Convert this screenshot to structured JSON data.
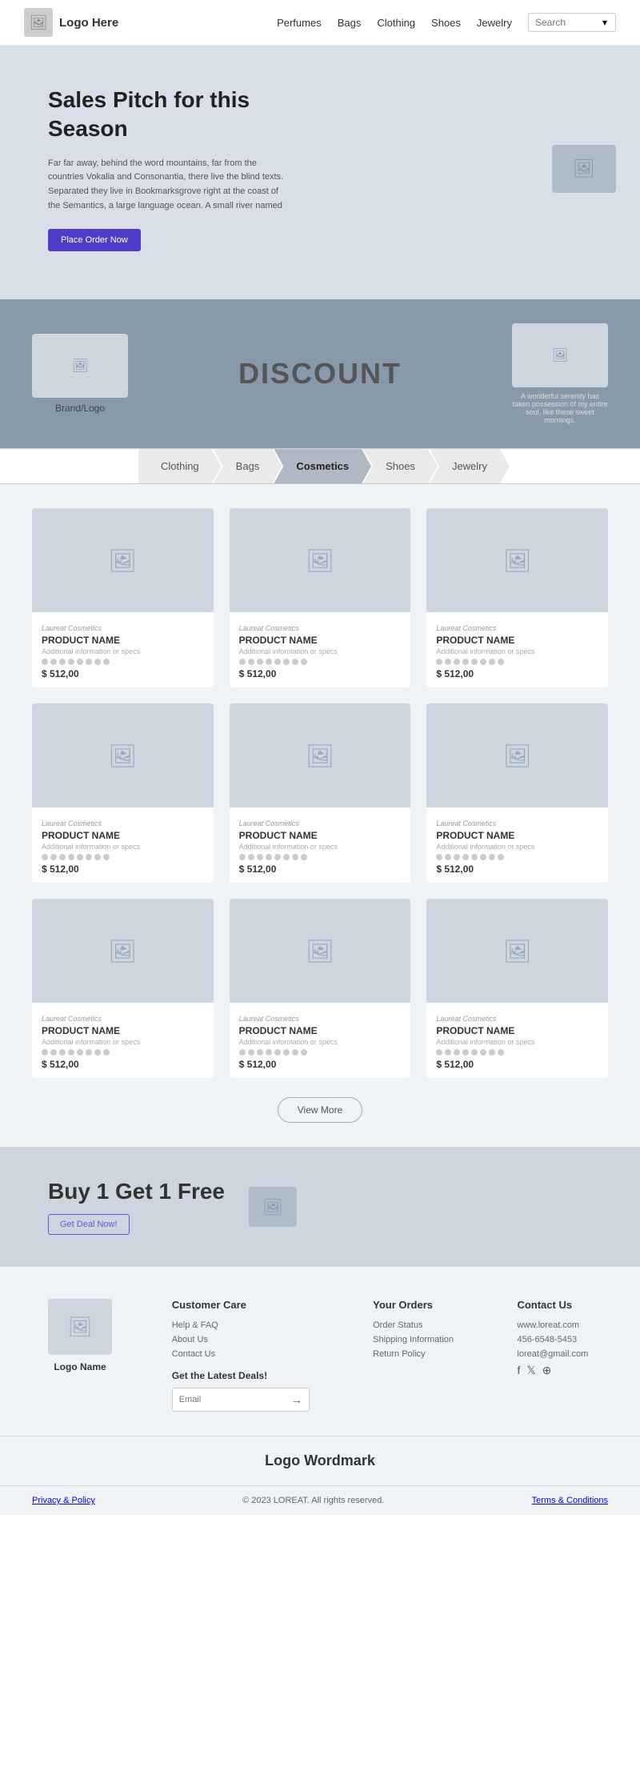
{
  "header": {
    "logo_text": "Logo Here",
    "nav_items": [
      "Perfumes",
      "Bags",
      "Clothing",
      "Shoes",
      "Jewelry"
    ],
    "search_placeholder": "Search"
  },
  "hero": {
    "title": "Sales Pitch for this Season",
    "description": "Far far away, behind the word mountains, far from the countries Vokalia and Consonantia, there live the blind texts. Separated they live in Bookmarksgrove right at the coast of the Semantics, a large language ocean. A small river named",
    "cta_label": "Place Order Now"
  },
  "discount": {
    "text": "DISCOUNT",
    "brand_label": "Brand/Logo",
    "right_text": "A wonderful serenity has taken possession of my entire soul, like these sweet mornings."
  },
  "category_tabs": [
    "Clothing",
    "Bags",
    "Cosmetics",
    "Shoes",
    "Jewelry"
  ],
  "active_tab": "Cosmetics",
  "products": [
    {
      "brand": "Laureat Cosmetics",
      "name": "PRODUCT NAME",
      "specs": "Additional information or specs",
      "price": "$ 512,00"
    },
    {
      "brand": "Laureat Cosmetics",
      "name": "PRODUCT NAME",
      "specs": "Additional information or specs",
      "price": "$ 512,00"
    },
    {
      "brand": "Laureat Cosmetics",
      "name": "PRODUCT NAME",
      "specs": "Additional information or specs",
      "price": "$ 512,00"
    },
    {
      "brand": "Laureat Cosmetics",
      "name": "PRODUCT NAME",
      "specs": "Additional information or specs",
      "price": "$ 512,00"
    },
    {
      "brand": "Laureat Cosmetics",
      "name": "PRODUCT NAME",
      "specs": "Additional information or specs",
      "price": "$ 512,00"
    },
    {
      "brand": "Laureat Cosmetics",
      "name": "PRODUCT NAME",
      "specs": "Additional information or specs",
      "price": "$ 512,00"
    },
    {
      "brand": "Laureat Cosmetics",
      "name": "PRODUCT NAME",
      "specs": "Additional information or specs",
      "price": "$ 512,00"
    },
    {
      "brand": "Laureat Cosmetics",
      "name": "PRODUCT NAME",
      "specs": "Additional information or specs",
      "price": "$ 512,00"
    },
    {
      "brand": "Laureat Cosmetics",
      "name": "PRODUCT NAME",
      "specs": "Additional information or specs",
      "price": "$ 512,00"
    }
  ],
  "view_more_label": "View More",
  "promo": {
    "title": "Buy 1 Get 1 Free",
    "cta_label": "Get Deal Now!"
  },
  "footer": {
    "logo_name": "Logo Name",
    "customer_care": {
      "heading": "Customer Care",
      "links": [
        "Help & FAQ",
        "About Us",
        "Contact Us"
      ]
    },
    "your_orders": {
      "heading": "Your Orders",
      "links": [
        "Order Status",
        "Shipping Information",
        "Return Policy"
      ]
    },
    "contact": {
      "heading": "Contact Us",
      "website": "www.loreat.com",
      "phone": "456-6548-5453",
      "email": "loreat@gmail.com"
    },
    "newsletter": {
      "label": "Get the Latest Deals!",
      "placeholder": "Email"
    },
    "wordmark": "Logo Wordmark",
    "copyright": "© 2023 LOREAT. All rights reserved.",
    "privacy_label": "Privacy & Policy",
    "terms_label": "Terms & Conditions"
  }
}
